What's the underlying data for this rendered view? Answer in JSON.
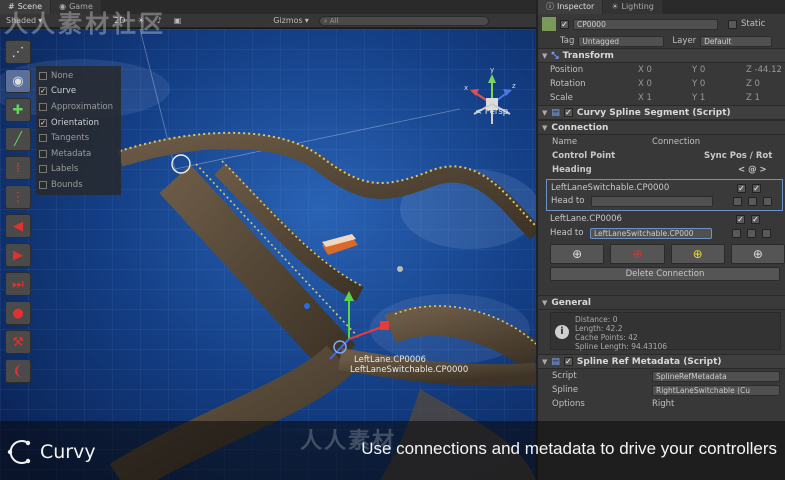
{
  "watermark": "人人素材社区",
  "watermark_bottom": "人人素材",
  "scene": {
    "tabs": [
      {
        "label": "Scene",
        "icon": "scene-icon"
      },
      {
        "label": "Game",
        "icon": "game-icon"
      }
    ],
    "toolbar": {
      "shading": "Shaded",
      "mode2d": "2D",
      "gizmos": "Gizmos",
      "search_placeholder": "All"
    },
    "view_options": [
      {
        "label": "None",
        "checked": false
      },
      {
        "label": "Curve",
        "checked": true
      },
      {
        "label": "Approximation",
        "checked": false
      },
      {
        "label": "Orientation",
        "checked": true
      },
      {
        "label": "Tangents",
        "checked": false
      },
      {
        "label": "Metadata",
        "checked": false
      },
      {
        "label": "Labels",
        "checked": false
      },
      {
        "label": "Bounds",
        "checked": false
      }
    ],
    "persp_label": "< Persp",
    "cp_label_1": "LeftLane.CP0006",
    "cp_label_2": "LeftLaneSwitchable.CP0000"
  },
  "inspector": {
    "tabs": [
      {
        "label": "Inspector",
        "icon": "info-icon"
      },
      {
        "label": "Lighting",
        "icon": "light-icon"
      }
    ],
    "object_name": "CP0000",
    "static_label": "Static",
    "tag_label": "Tag",
    "tag_value": "Untagged",
    "layer_label": "Layer",
    "layer_value": "Default",
    "transform": {
      "title": "Transform",
      "position": {
        "label": "Position",
        "x": "0",
        "y": "0",
        "z": "-44.12"
      },
      "rotation": {
        "label": "Rotation",
        "x": "0",
        "y": "0",
        "z": "0"
      },
      "scale": {
        "label": "Scale",
        "x": "1",
        "y": "1",
        "z": "1"
      }
    },
    "segment_title": "Curvy Spline Segment (Script)",
    "connection": {
      "title": "Connection",
      "name_label": "Name",
      "name_value": "Connection",
      "control_point_header": "Control Point",
      "sync_header": "Sync Pos / Rot",
      "heading_label": "Heading",
      "heading_symbols": "<  @  >",
      "cp1_name": "LeftLaneSwitchable.CP0000",
      "cp1_head_to_label": "Head to",
      "cp1_head_to_value": "",
      "cp2_name": "LeftLane.CP0006",
      "cp2_head_to_label": "Head to",
      "cp2_head_to_value": "LeftLaneSwitchable.CP000",
      "delete_label": "Delete Connection"
    },
    "general": {
      "title": "General",
      "distance": "Distance: 0",
      "length": "Length: 42.2",
      "cache_points": "Cache Points: 42",
      "spline_length": "Spline Length: 94.43106"
    },
    "metadata": {
      "title": "Spline Ref Metadata (Script)",
      "script_label": "Script",
      "script_value": "SplineRefMetadata",
      "spline_label": "Spline",
      "spline_value": "RightLaneSwitchable (Cu",
      "options_label": "Options",
      "options_value": "Right"
    }
  },
  "banner": {
    "logo": "Curvy",
    "tagline": "Use connections and metadata to drive your controllers"
  },
  "colors": {
    "accent_blue": "#6b93c8",
    "track_yellow": "#d9c86a",
    "sky": "#123a78",
    "btn_red": "#d23030",
    "btn_green": "#3fa33f"
  }
}
